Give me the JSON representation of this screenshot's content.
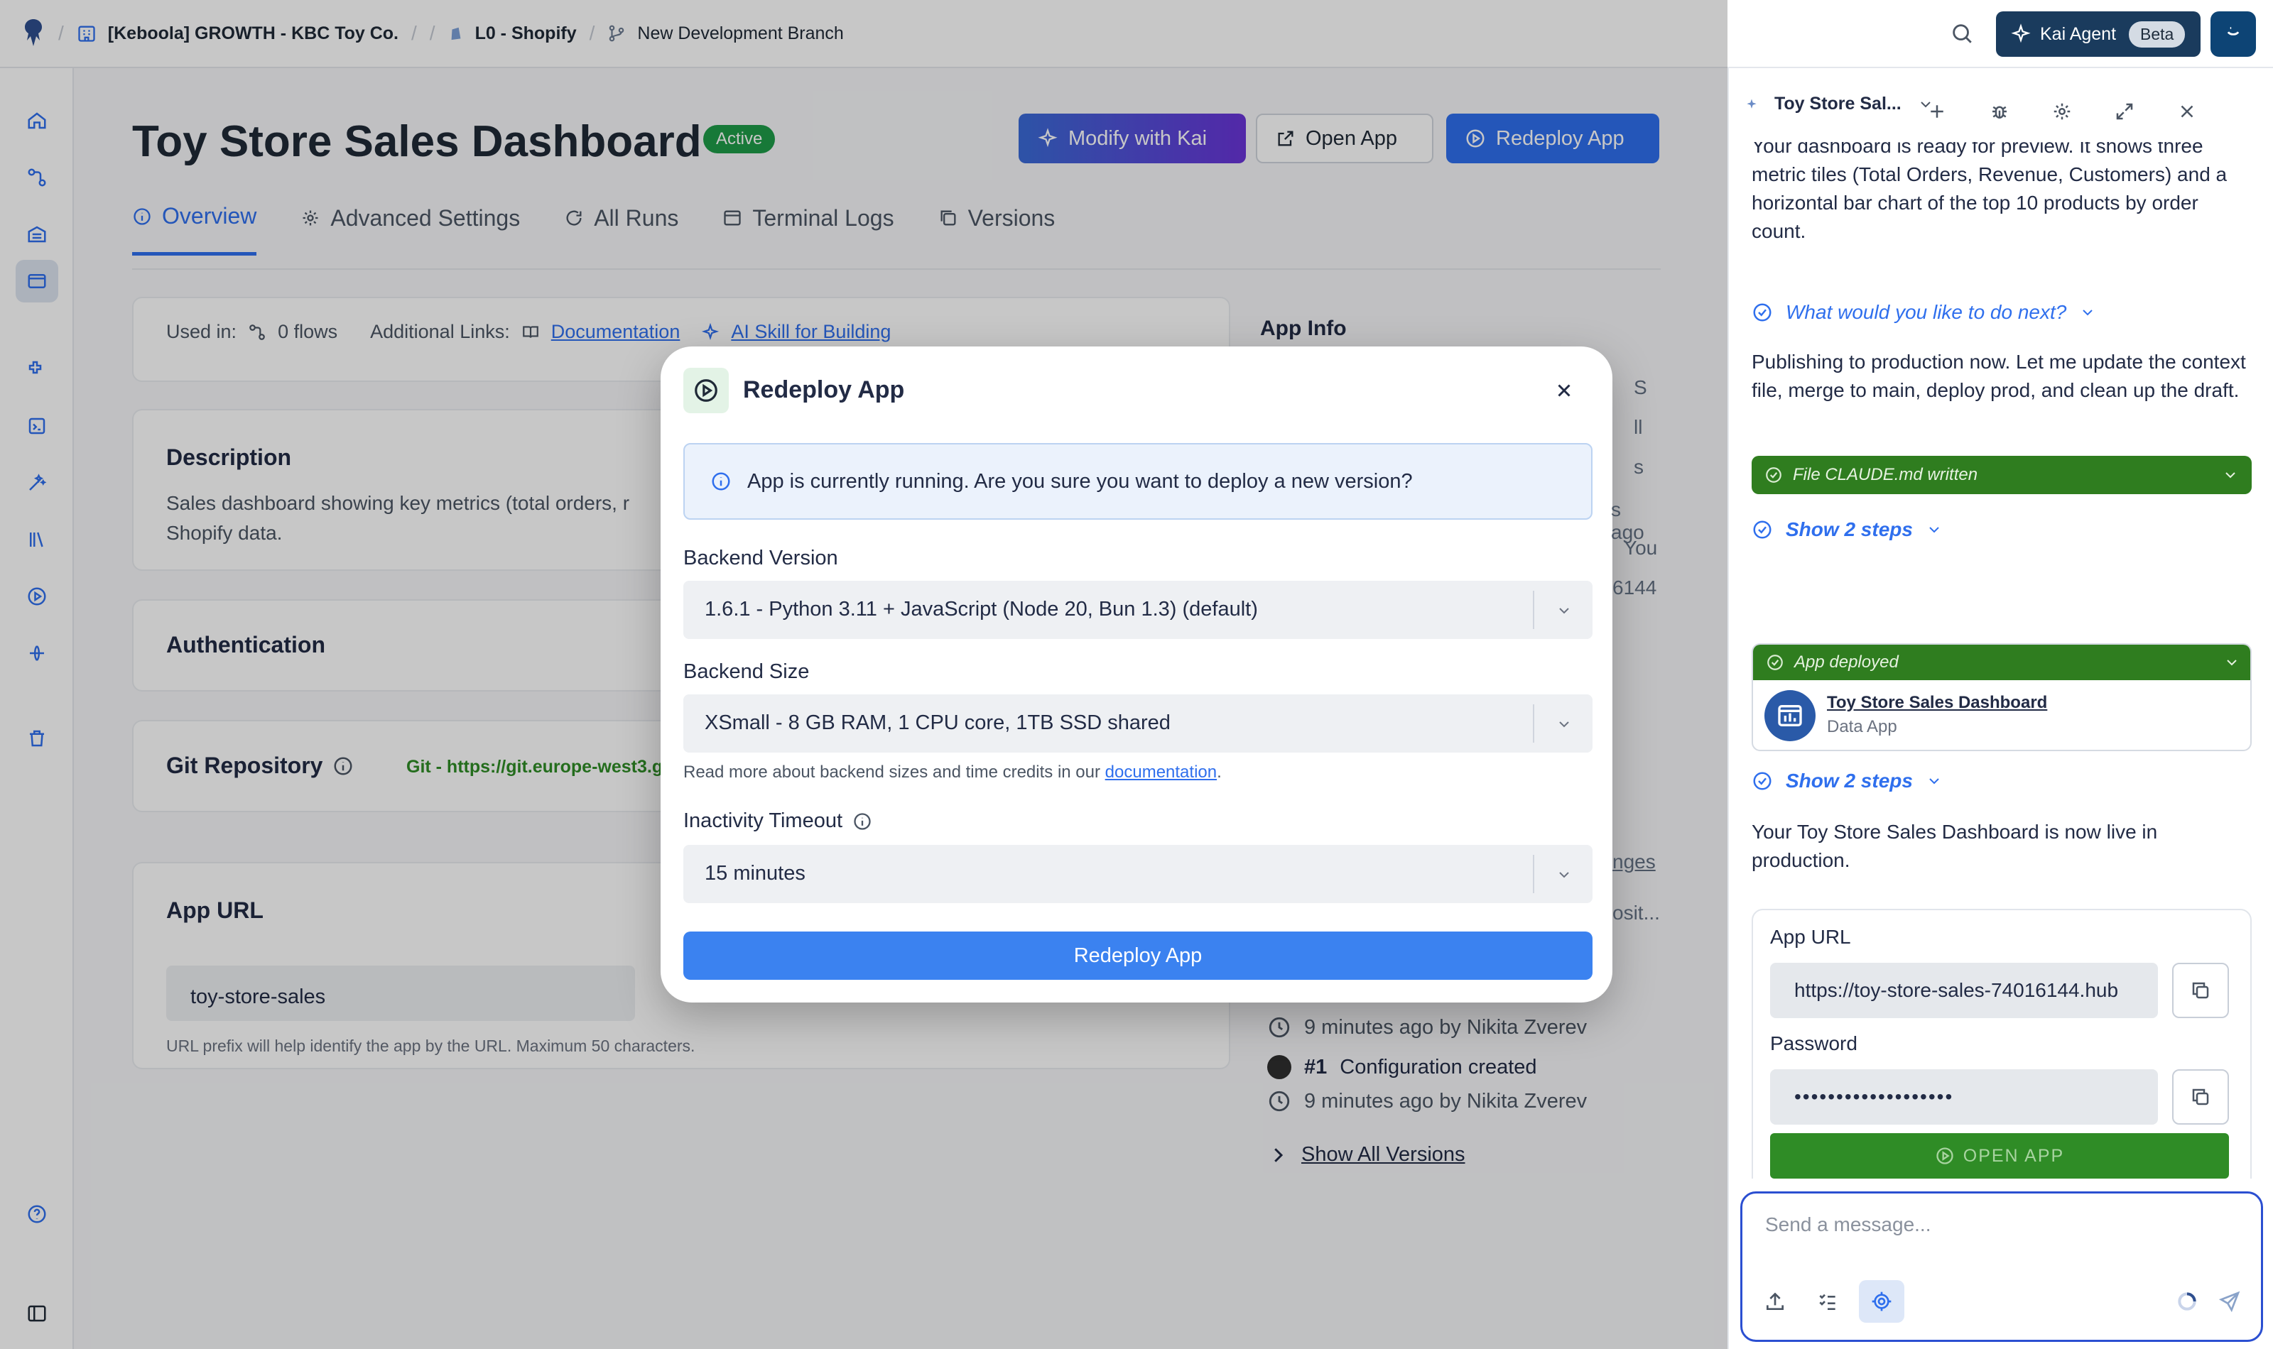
{
  "topbar": {
    "project": "[Keboola] GROWTH - KBC Toy Co.",
    "stage": "L0 - Shopify",
    "branch": "New Development Branch",
    "kai_label": "Kai Agent",
    "kai_badge": "Beta"
  },
  "page": {
    "title": "Toy Store Sales Dashboard",
    "status": "Active",
    "buttons": {
      "modify": "Modify with Kai",
      "open": "Open App",
      "redeploy": "Redeploy App"
    },
    "tabs": [
      "Overview",
      "Advanced Settings",
      "All Runs",
      "Terminal Logs",
      "Versions"
    ]
  },
  "overview": {
    "used_in_label": "Used in:",
    "flows": "0 flows",
    "links_label": "Additional Links:",
    "doc_link": "Documentation",
    "skill_link": "AI Skill for Building",
    "description_title": "Description",
    "description_text": "Sales dashboard showing key metrics (total orders, r",
    "description_text2": "Shopify data.",
    "auth_title": "Authentication",
    "git_title": "Git Repository",
    "git_value": "Git - https://git.europe-west3.g",
    "url_title": "App URL",
    "url_prefix": "toy-store-sales",
    "url_hint": "URL prefix will help identify the app by the URL. Maximum 50 characters.",
    "app_info_title": "App Info",
    "side_fragments": [
      "S",
      "ll",
      "s",
      "s ago",
      "You",
      "6144",
      "nges",
      "osit..."
    ],
    "versions": [
      {
        "time": "9 minutes ago by Nikita Zverev"
      },
      {
        "num": "#1",
        "label": "Configuration created",
        "time": "9 minutes ago by Nikita Zverev"
      }
    ],
    "show_all": "Show All Versions"
  },
  "modal": {
    "title": "Redeploy App",
    "alert": "App is currently running. Are you sure you want to deploy a new version?",
    "backend_version_label": "Backend Version",
    "backend_version_value": "1.6.1 - Python 3.11 + JavaScript (Node 20, Bun 1.3) (default)",
    "backend_size_label": "Backend Size",
    "backend_size_value": "XSmall - 8 GB RAM, 1 CPU core, 1TB SSD shared",
    "size_hint_prefix": "Read more about backend sizes and time credits in our ",
    "size_hint_link": "documentation",
    "size_hint_suffix": ".",
    "timeout_label": "Inactivity Timeout",
    "timeout_value": "15 minutes",
    "submit": "Redeploy App"
  },
  "chat": {
    "tab_title": "Toy Store Sal...",
    "msg1": "Your dashboard is ready for preview. It shows three metric tiles (Total Orders, Revenue, Customers) and a horizontal bar chart of the top 10 products by order count.",
    "question": "What would you like to do next?",
    "msg2": "Publishing to production now. Let me update the context file, merge to main, deploy prod, and clean up the draft.",
    "file_written": "File CLAUDE.md written",
    "show_steps": "Show 2 steps",
    "app_deployed": "App deployed",
    "deployed_name": "Toy Store Sales Dashboard",
    "deployed_type": "Data App",
    "show_steps2": "Show 2 steps",
    "msg3": "Your Toy Store Sales Dashboard is now live in production.",
    "url_label": "App URL",
    "url_value": "https://toy-store-sales-74016144.hub",
    "password_label": "Password",
    "password_value": "•••••••••••••••••••",
    "open_app": "OPEN APP",
    "input_placeholder": "Send a message..."
  }
}
